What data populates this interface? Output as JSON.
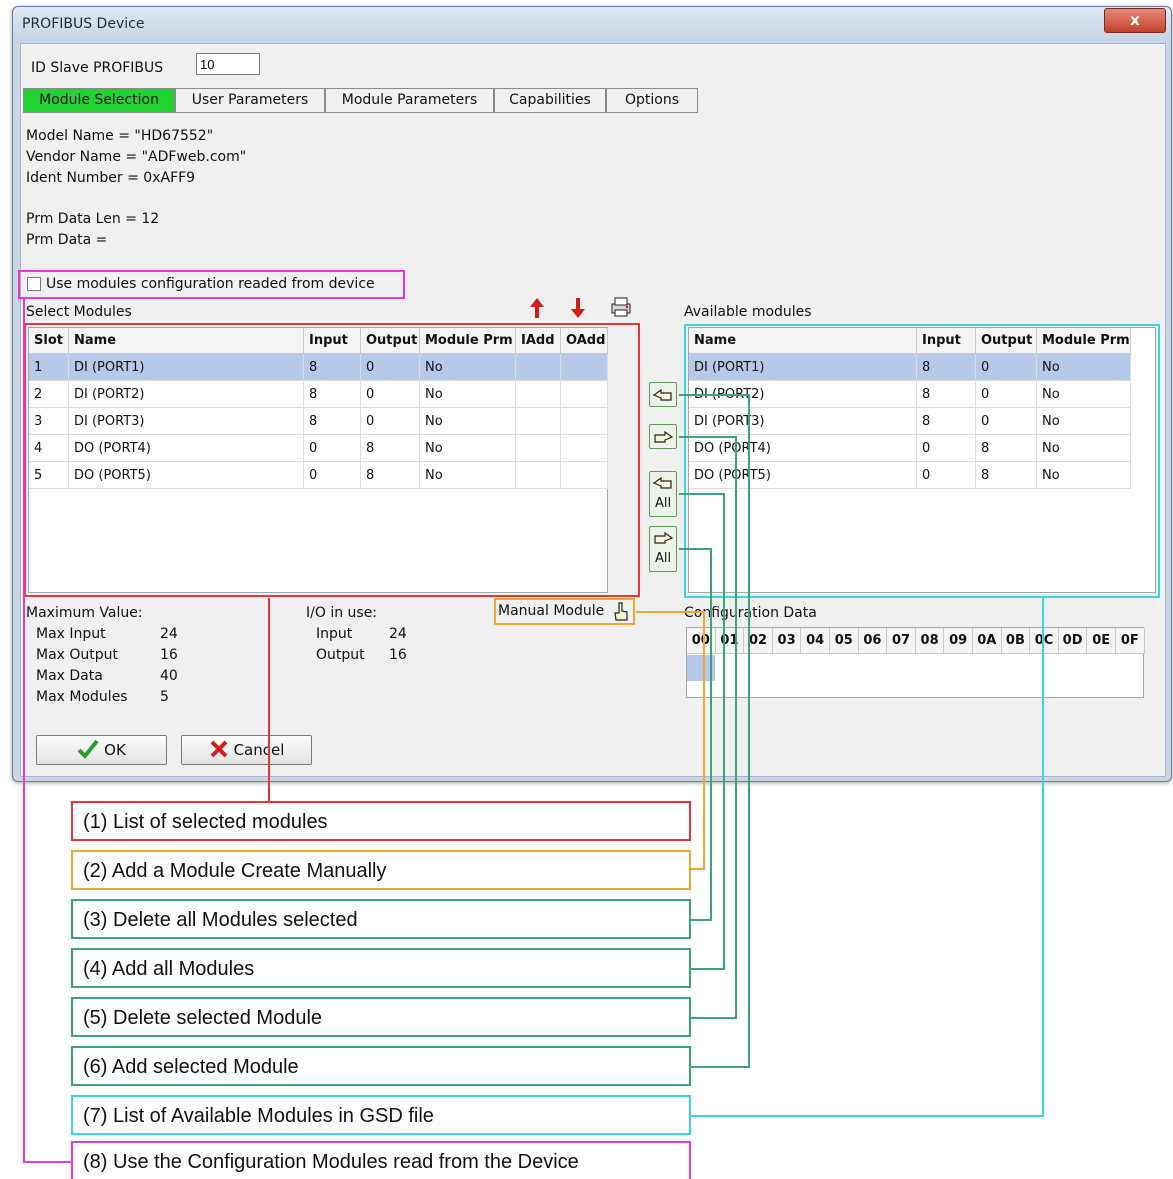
{
  "window": {
    "title": "PROFIBUS Device",
    "close_glyph": "x"
  },
  "id_slave": {
    "label": "ID Slave PROFIBUS",
    "value": "10"
  },
  "tabs": [
    {
      "label": "Module Selection",
      "active": true
    },
    {
      "label": "User Parameters"
    },
    {
      "label": "Module Parameters"
    },
    {
      "label": "Capabilities"
    },
    {
      "label": "Options"
    }
  ],
  "info": {
    "model_name": "Model Name = \"HD67552\"",
    "vendor_name": "Vendor Name = \"ADFweb.com\"",
    "ident_number": "Ident Number = 0xAFF9",
    "prm_data_len": "Prm Data Len = 12",
    "prm_data": "Prm Data ="
  },
  "use_device_config": {
    "label": "Use modules configuration readed from device",
    "checked": false
  },
  "selected_modules": {
    "title": "Select Modules",
    "columns": [
      "Slot",
      "Name",
      "Input",
      "Output",
      "Module Prm",
      "IAdd",
      "OAdd"
    ],
    "rows": [
      [
        "1",
        "DI  (PORT1)",
        "8",
        "0",
        "No",
        "",
        ""
      ],
      [
        "2",
        "DI  (PORT2)",
        "8",
        "0",
        "No",
        "",
        ""
      ],
      [
        "3",
        "DI  (PORT3)",
        "8",
        "0",
        "No",
        "",
        ""
      ],
      [
        "4",
        "DO  (PORT4)",
        "0",
        "8",
        "No",
        "",
        ""
      ],
      [
        "5",
        "DO  (PORT5)",
        "0",
        "8",
        "No",
        "",
        ""
      ]
    ],
    "selected_row": 0
  },
  "available_modules": {
    "title": "Available modules",
    "columns": [
      "Name",
      "Input",
      "Output",
      "Module Prm"
    ],
    "rows": [
      [
        "DI  (PORT1)",
        "8",
        "0",
        "No"
      ],
      [
        "DI  (PORT2)",
        "8",
        "0",
        "No"
      ],
      [
        "DI  (PORT3)",
        "8",
        "0",
        "No"
      ],
      [
        "DO  (PORT4)",
        "0",
        "8",
        "No"
      ],
      [
        "DO  (PORT5)",
        "0",
        "8",
        "No"
      ]
    ],
    "selected_row": 0
  },
  "side_buttons": {
    "all_label": "All"
  },
  "limits": {
    "title": "Maximum Value:",
    "rows": [
      {
        "label": "Max Input",
        "value": "24"
      },
      {
        "label": "Max Output",
        "value": "16"
      },
      {
        "label": "Max Data",
        "value": "40"
      },
      {
        "label": "Max Modules",
        "value": "5"
      }
    ]
  },
  "io_in_use": {
    "title": "I/O in use:",
    "rows": [
      {
        "label": "Input",
        "value": "24"
      },
      {
        "label": "Output",
        "value": "16"
      }
    ]
  },
  "manual_module": {
    "label": "Manual Module"
  },
  "configuration_data": {
    "title": "Configuration Data",
    "columns": [
      "00",
      "01",
      "02",
      "03",
      "04",
      "05",
      "06",
      "07",
      "08",
      "09",
      "0A",
      "0B",
      "0C",
      "0D",
      "0E",
      "0F"
    ]
  },
  "buttons": {
    "ok": "OK",
    "cancel": "Cancel"
  },
  "callouts": [
    {
      "text": "(1) List of selected modules",
      "color": "#e8343a"
    },
    {
      "text": "(2) Add a Module Create Manually",
      "color": "#f0a830"
    },
    {
      "text": "(3) Delete all Modules selected",
      "color": "#3aa576"
    },
    {
      "text": "(4) Add all Modules",
      "color": "#3aa576"
    },
    {
      "text": "(5) Delete selected Module",
      "color": "#3aa576"
    },
    {
      "text": "(6) Add selected Module",
      "color": "#3aa576"
    },
    {
      "text": "(7) List of Available Modules in GSD file",
      "color": "#38d6e0"
    },
    {
      "text": "(8) Use the Configuration Modules read from the Device",
      "color": "#e838d8"
    }
  ],
  "colors": {
    "active_tab": "#22d431",
    "selection": "#b7c9e8"
  },
  "icons": [
    "move-up-icon",
    "move-down-icon",
    "print-icon",
    "hand-left-icon",
    "hand-right-icon",
    "hand-point-icon",
    "check-icon",
    "cross-icon"
  ]
}
